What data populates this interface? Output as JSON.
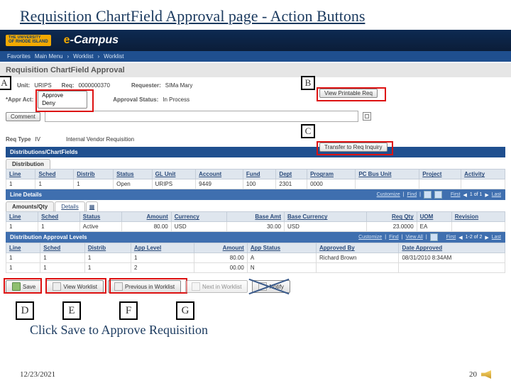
{
  "slide": {
    "title": "Requisition ChartField Approval page - Action Buttons",
    "instruction": "Click Save to Approve Requisition",
    "date": "12/23/2021",
    "pageno": "20"
  },
  "banner": {
    "uni_top": "THE UNIVERSITY",
    "uni_bot": "OF RHODE ISLAND",
    "ecampus_e": "e",
    "ecampus_rest": "-Campus"
  },
  "favbar": {
    "fav": "Favorites",
    "m": "Main Menu",
    "w1": "Worklist",
    "w2": "Worklist"
  },
  "pagetitle": "Requisition ChartField Approval",
  "info": {
    "unit_lbl": "Unit:",
    "unit": "URIPS",
    "req_lbl": "Req:",
    "req": "0000000370",
    "requester_lbl": "Requester:",
    "requester": "SIMa Mary",
    "appr_lbl": "*Appr Act:",
    "appr_opts": [
      "Approve",
      "Deny"
    ],
    "status_lbl": "Approval Status:",
    "status": "In Process",
    "comment_lbl": "Comment"
  },
  "buttons": {
    "view_printable": "View Printable Req",
    "transfer": "Transfer to Req Inquiry"
  },
  "reqtype": {
    "lbl": "Req Type",
    "code": "IV",
    "desc": "Internal Vendor Requisition"
  },
  "dist": {
    "bar": "Distributions/ChartFields",
    "tab": "Distribution",
    "cols": [
      "Line",
      "Sched",
      "Distrib",
      "Status",
      "GL Unit",
      "Account",
      "Fund",
      "Dept",
      "Program",
      "PC Bus Unit",
      "Project",
      "Activity"
    ],
    "row": [
      "1",
      "1",
      "1",
      "Open",
      "URIPS",
      "9449",
      "100",
      "2301",
      "0000",
      "",
      "",
      ""
    ]
  },
  "line": {
    "bar": "Line Details",
    "tab1": "Amounts/Qty",
    "tab2": "Details",
    "nav": {
      "cust": "Customize",
      "find": "Find",
      "first": "First",
      "range": "1 of 1",
      "last": "Last"
    },
    "cols": [
      "Line",
      "Sched",
      "Status",
      "Amount",
      "Currency",
      "Base Amt",
      "Base Currency",
      "Req Qty",
      "UOM",
      "Revision"
    ],
    "row": [
      "1",
      "1",
      "Active",
      "80.00",
      "USD",
      "30.00",
      "USD",
      "23.0000",
      "EA",
      ""
    ]
  },
  "appr": {
    "bar": "Distribution Approval Levels",
    "nav": {
      "cust": "Customize",
      "find": "Find",
      "va": "View All",
      "first": "First",
      "range": "1-2 of 2",
      "last": "Last"
    },
    "cols": [
      "Line",
      "Sched",
      "Distrib",
      "App Level",
      "Amount",
      "App Status",
      "Approved By",
      "Date Approved"
    ],
    "rows": [
      [
        "1",
        "1",
        "1",
        "1",
        "80.00",
        "A",
        "Richard Brown",
        "08/31/2010  8:34AM"
      ],
      [
        "1",
        "1",
        "1",
        "2",
        "00.00",
        "N",
        "",
        ""
      ]
    ]
  },
  "bottom": {
    "save": "Save",
    "vw": "View Worklist",
    "prev": "Previous in Worklist",
    "next": "Next in Worklist",
    "notify": "Notify"
  },
  "callouts": {
    "A": "A",
    "B": "B",
    "C": "C",
    "D": "D",
    "E": "E",
    "F": "F",
    "G": "G"
  }
}
